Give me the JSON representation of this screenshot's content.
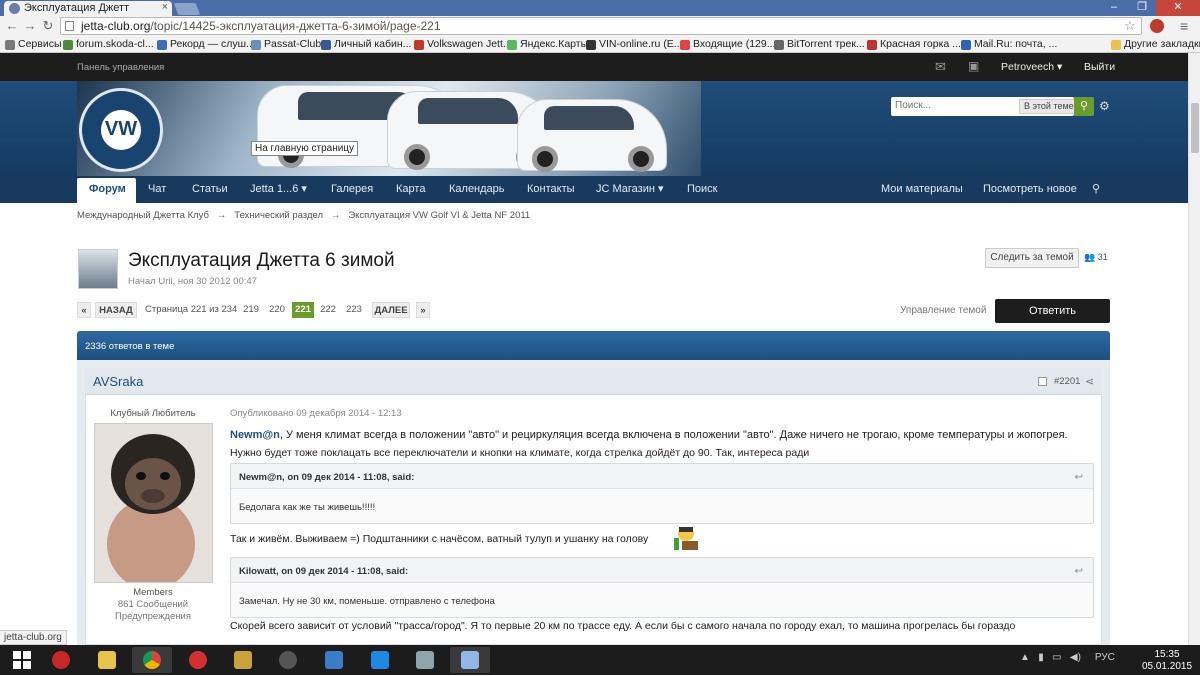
{
  "browser": {
    "tab_title": "Эксплуатация Джетт",
    "url_domain": "jetta-club.org",
    "url_path": "/topic/14425-эксплуатация-джетта-6-зимой/page-221",
    "bookmarks": [
      "Сервисы",
      "forum.skoda-cl...",
      "Рекорд — слуш...",
      "Passat-Club",
      "Личный кабин...",
      "Volkswagen Jett...",
      "Яндекс.Карты",
      "VIN-online.ru (E...",
      "Входящие (129...",
      "BitTorrent трек...",
      "Красная горка ...",
      "Mail.Ru: почта, ..."
    ],
    "other_bookmarks": "Другие закладки",
    "status": "jetta-club.org"
  },
  "site": {
    "control_panel": "Панель управления",
    "username": "Petroveech",
    "logout": "Выйти",
    "home_tooltip": "На главную страницу",
    "search_placeholder": "Поиск...",
    "search_scope": "В этой теме",
    "nav": [
      "Форум",
      "Чат",
      "Статьи",
      "Jetta 1...6",
      "Галерея",
      "Карта",
      "Календарь",
      "Контакты",
      "JC Магазин",
      "Поиск"
    ],
    "nav_right": [
      "Мои материалы",
      "Посмотреть новое"
    ]
  },
  "breadcrumb": [
    "Международный Джетта Клуб",
    "Технический раздел",
    "Эксплуатация VW Golf VI & Jetta NF 2011"
  ],
  "topic": {
    "title": "Эксплуатация Джетта 6 зимой",
    "meta": "Начал Urii, ноя 30 2012 00:47",
    "follow": "Следить за темой",
    "followers": "31",
    "manage": "Управление темой",
    "reply": "Ответить",
    "replies_count": "2336 ответов в теме"
  },
  "pagination": {
    "first": "«",
    "prev": "НАЗАД",
    "info": "Страница 221 из 234",
    "pages": [
      "219",
      "220",
      "221",
      "222",
      "223"
    ],
    "current": "221",
    "next": "ДАЛЕЕ",
    "last": "»"
  },
  "post": {
    "author": "AVSraka",
    "number": "#2201",
    "user_title": "Клубный Любитель",
    "group": "Members",
    "post_count": "861 Сообщений",
    "warnings": "Предупреждения",
    "date": "Опубликовано 09 декабря 2014 - 12:13",
    "mention": "Newm@n",
    "line1": ", У меня климат всегда в положении \"авто\" и рециркуляция всегда включена в положении \"авто\". Даже ничего не трогаю, кроме температуры и жопогрея.",
    "line2": "Нужно будет тоже поклацать все переключатели и кнопки на климате, когда стрелка дойдёт до 90. Так, интереса ради",
    "quote1_head": "Newm@n, on 09 дек 2014 - 11:08, said:",
    "quote1_body": "Бедолага как же ты живешь!!!!!",
    "line3": "Так и живём. Выживаем =) Подштанники с начёсом, ватный тулуп и ушанку на голову",
    "quote2_head": "Kilowatt, on 09 дек 2014 - 11:08, said:",
    "quote2_body": "Замечал. Ну не 30 км, поменьше. отправлено с телефона",
    "line4": "Скорей всего зависит от условий \"трасса/город\". Я то первые 20 км по трассе еду. А если бы с самого начала по городу ехал, то машина прогрелась бы гораздо"
  },
  "taskbar": {
    "lang": "РУС",
    "time": "15:35",
    "date": "05.01.2015"
  }
}
